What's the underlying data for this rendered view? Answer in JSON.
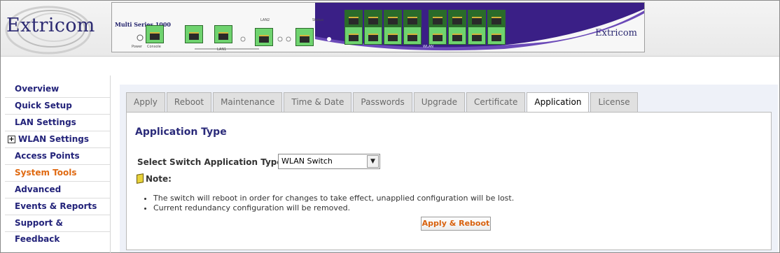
{
  "header": {
    "brand": "Extricom",
    "device_model": "Multi Series 1000",
    "device_logo": "Extricom",
    "device_labels": {
      "power": "Power",
      "console": "Console",
      "lan1": "LAN1",
      "lan2": "LAN2",
      "status": "Status",
      "wlan": "WLAN"
    },
    "port_numbers_top": [
      "1",
      "3",
      "5",
      "7",
      "9",
      "11",
      "13",
      "15"
    ],
    "port_numbers_bottom": [
      "2",
      "4",
      "6",
      "8",
      "10",
      "12",
      "14",
      "16"
    ]
  },
  "sidebar": {
    "items": [
      {
        "label": "Overview"
      },
      {
        "label": "Quick Setup"
      },
      {
        "label": "LAN Settings"
      },
      {
        "label": "WLAN Settings",
        "expandable": true
      },
      {
        "label": "Access Points"
      },
      {
        "label": "System Tools",
        "active": true
      },
      {
        "label": "Advanced"
      },
      {
        "label": "Events & Reports"
      },
      {
        "label": "Support & Feedback"
      }
    ]
  },
  "tabs": [
    {
      "label": "Apply"
    },
    {
      "label": "Reboot"
    },
    {
      "label": "Maintenance"
    },
    {
      "label": "Time & Date"
    },
    {
      "label": "Passwords"
    },
    {
      "label": "Upgrade"
    },
    {
      "label": "Certificate"
    },
    {
      "label": "Application",
      "active": true
    },
    {
      "label": "License"
    }
  ],
  "content": {
    "title": "Application Type",
    "field_label": "Select Switch Application Type:",
    "select_value": "WLAN Switch",
    "note_label": "Note:",
    "notes": [
      "The switch will reboot in order for changes to take effect, unapplied configuration will be lost.",
      "Current redundancy configuration will be removed."
    ],
    "button_label": "Apply & Reboot"
  },
  "colors": {
    "nav_text": "#23237a",
    "nav_active": "#e06a12",
    "title": "#2b2b7a",
    "button_text": "#d9620e",
    "panel_bg": "#eef1f8"
  }
}
